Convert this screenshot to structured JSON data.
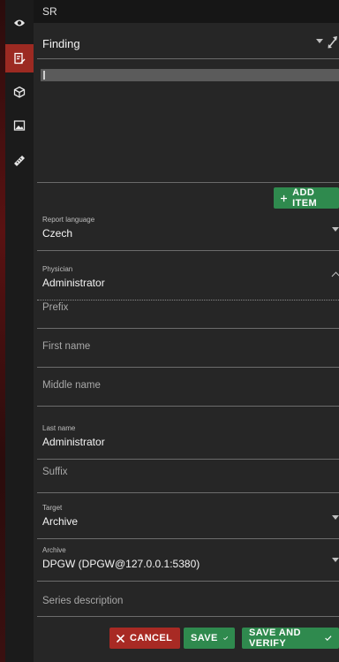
{
  "sidebar": {
    "items": [
      {
        "icon": "eye-icon",
        "active": false
      },
      {
        "icon": "document-edit-icon",
        "active": true
      },
      {
        "icon": "cube-icon",
        "active": false
      },
      {
        "icon": "image-icon",
        "active": false
      },
      {
        "icon": "ruler-icon",
        "active": false
      }
    ],
    "accent_color": "#9c2a22"
  },
  "header": {
    "title": "SR"
  },
  "finding": {
    "label": "Finding"
  },
  "add_item": {
    "label": "ADD ITEM"
  },
  "form": {
    "report_language": {
      "label": "Report language",
      "value": "Czech"
    },
    "physician": {
      "label": "Physician",
      "value": "Administrator"
    },
    "prefix": {
      "placeholder": "Prefix"
    },
    "first_name": {
      "placeholder": "First name"
    },
    "middle_name": {
      "placeholder": "Middle name"
    },
    "last_name": {
      "label": "Last name",
      "value": "Administrator"
    },
    "suffix": {
      "placeholder": "Suffix"
    },
    "target": {
      "label": "Target",
      "value": "Archive"
    },
    "archive": {
      "label": "Archive",
      "value": "DPGW (DPGW@127.0.0.1:5380)"
    },
    "series_description": {
      "placeholder": "Series description"
    }
  },
  "actions": {
    "cancel": "CANCEL",
    "save": "SAVE",
    "save_verify": "SAVE AND VERIFY"
  },
  "colors": {
    "green": "#2f8a4e",
    "red": "#a82a24"
  }
}
